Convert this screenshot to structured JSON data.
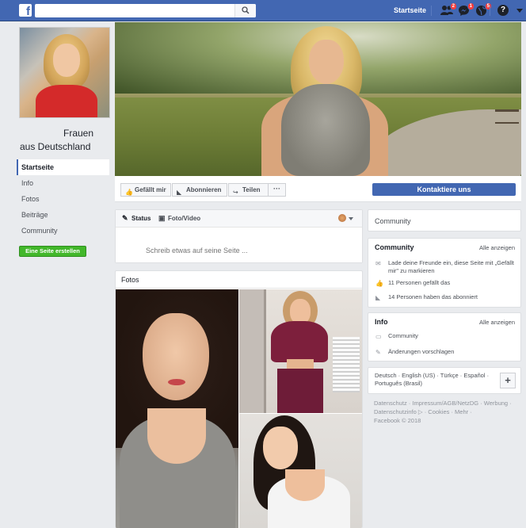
{
  "topbar": {
    "logo": "f",
    "search_placeholder": "",
    "home_link": "Startseite",
    "friend_requests_badge": "2",
    "messages_badge": "1",
    "notifications_badge": "5",
    "help_label": "?"
  },
  "page": {
    "name_line1": "Frauen",
    "name_line2": "aus Deutschland"
  },
  "nav": {
    "items": [
      {
        "label": "Startseite",
        "active": true
      },
      {
        "label": "Info"
      },
      {
        "label": "Fotos"
      },
      {
        "label": "Beiträge"
      },
      {
        "label": "Community"
      }
    ],
    "create_page": "Eine Seite erstellen"
  },
  "actions": {
    "like": "Gefällt mir",
    "follow": "Abonnieren",
    "share": "Teilen",
    "more": "···",
    "contact": "Kontaktiere uns"
  },
  "composer": {
    "tab_status": "Status",
    "tab_photo": "Foto/Video",
    "placeholder": "Schreib etwas auf seine Seite ..."
  },
  "photos": {
    "title": "Fotos"
  },
  "right": {
    "community_title": "Community",
    "community_section": {
      "title": "Community",
      "see_all": "Alle anzeigen",
      "invite_text": "Lade deine Freunde ein, diese Seite mit „Gefällt mir\" zu markieren",
      "likes_text": "11 Personen gefällt das",
      "follows_text": "14 Personen haben das abonniert"
    },
    "info_section": {
      "title": "Info",
      "see_all": "Alle anzeigen",
      "category": "Community",
      "suggest_edits": "Änderungen vorschlagen"
    },
    "languages": "Deutsch · English (US) · Türkçe · Español · Português (Brasil)",
    "plus": "+",
    "footer_line1": "Datenschutz · Impressum/AGB/NetzDG · Werbung ·",
    "footer_line2": "Datenschutzinfo ▷ · Cookies · Mehr ·",
    "footer_line3": "Facebook © 2018"
  },
  "colors": {
    "brand": "#4267b2",
    "create_button": "#42b72a",
    "badge": "#fa3e3e"
  }
}
